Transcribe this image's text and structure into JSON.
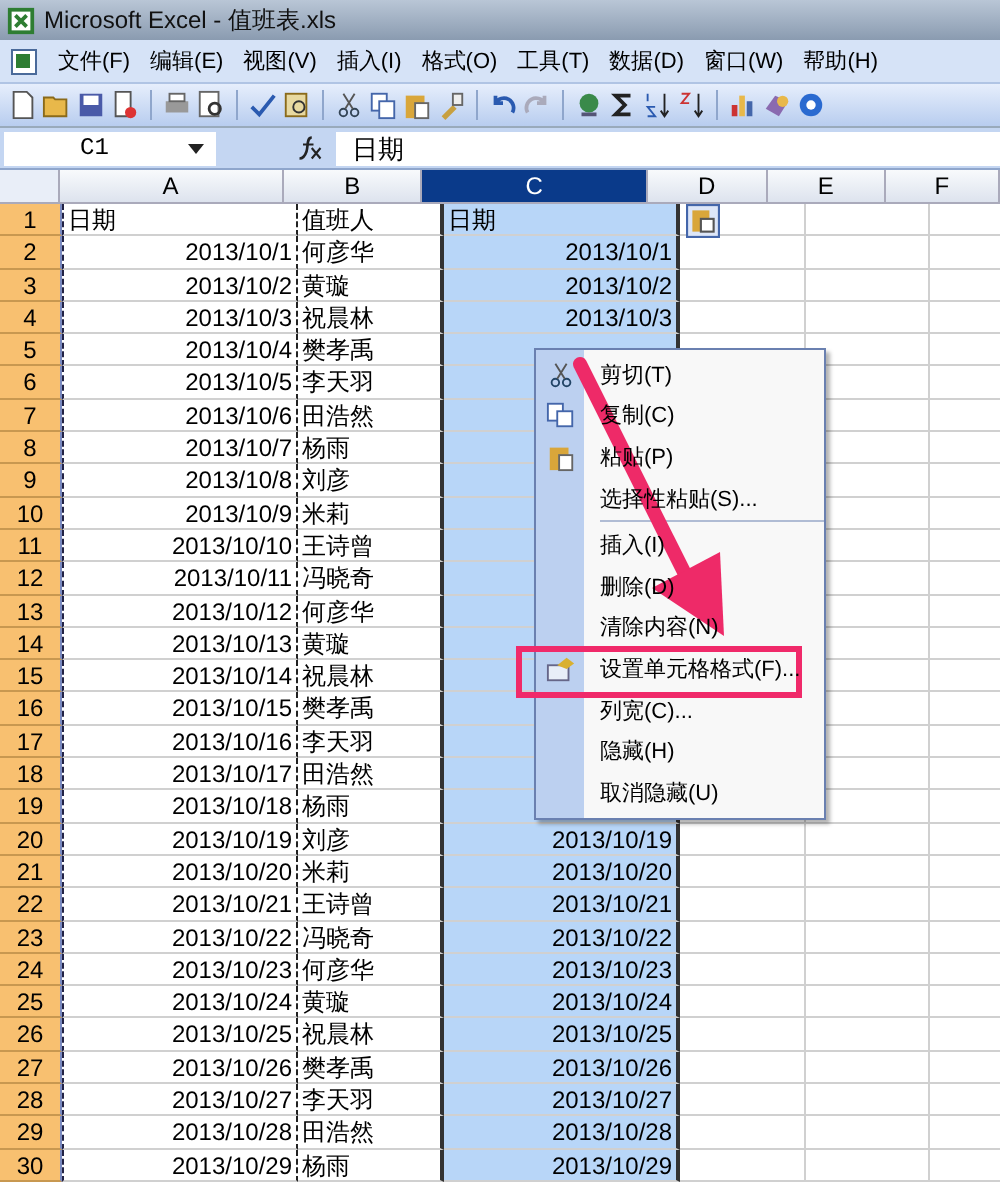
{
  "window": {
    "title": "Microsoft Excel - 值班表.xls"
  },
  "menu_bar": [
    {
      "label": "文件(F)"
    },
    {
      "label": "编辑(E)"
    },
    {
      "label": "视图(V)"
    },
    {
      "label": "插入(I)"
    },
    {
      "label": "格式(O)"
    },
    {
      "label": "工具(T)"
    },
    {
      "label": "数据(D)"
    },
    {
      "label": "窗口(W)"
    },
    {
      "label": "帮助(H)"
    }
  ],
  "name_box": "C1",
  "formula": "日期",
  "columns": [
    {
      "label": "A",
      "selected": false
    },
    {
      "label": "B",
      "selected": false
    },
    {
      "label": "C",
      "selected": true
    },
    {
      "label": "D",
      "selected": false
    },
    {
      "label": "E",
      "selected": false
    },
    {
      "label": "F",
      "selected": false
    }
  ],
  "rows": [
    {
      "number": "1",
      "cells": [
        "日期",
        "值班人",
        "日期"
      ]
    },
    {
      "number": "2",
      "cells": [
        "2013/10/1",
        "何彦华",
        "2013/10/1"
      ]
    },
    {
      "number": "3",
      "cells": [
        "2013/10/2",
        "黄璇",
        "2013/10/2"
      ]
    },
    {
      "number": "4",
      "cells": [
        "2013/10/3",
        "祝晨林",
        "2013/10/3"
      ]
    },
    {
      "number": "5",
      "cells": [
        "2013/10/4",
        "樊孝禹",
        null
      ]
    },
    {
      "number": "6",
      "cells": [
        "2013/10/5",
        "李天羽",
        null
      ]
    },
    {
      "number": "7",
      "cells": [
        "2013/10/6",
        "田浩然",
        null
      ]
    },
    {
      "number": "8",
      "cells": [
        "2013/10/7",
        "杨雨",
        null
      ]
    },
    {
      "number": "9",
      "cells": [
        "2013/10/8",
        "刘彦",
        null
      ]
    },
    {
      "number": "10",
      "cells": [
        "2013/10/9",
        "米莉",
        null
      ]
    },
    {
      "number": "11",
      "cells": [
        "2013/10/10",
        "王诗曾",
        null
      ]
    },
    {
      "number": "12",
      "cells": [
        "2013/10/11",
        "冯晓奇",
        null
      ]
    },
    {
      "number": "13",
      "cells": [
        "2013/10/12",
        "何彦华",
        null
      ]
    },
    {
      "number": "14",
      "cells": [
        "2013/10/13",
        "黄璇",
        null
      ]
    },
    {
      "number": "15",
      "cells": [
        "2013/10/14",
        "祝晨林",
        null
      ]
    },
    {
      "number": "16",
      "cells": [
        "2013/10/15",
        "樊孝禹",
        null
      ]
    },
    {
      "number": "17",
      "cells": [
        "2013/10/16",
        "李天羽",
        null
      ]
    },
    {
      "number": "18",
      "cells": [
        "2013/10/17",
        "田浩然",
        null
      ]
    },
    {
      "number": "19",
      "cells": [
        "2013/10/18",
        "杨雨",
        null
      ]
    },
    {
      "number": "20",
      "cells": [
        "2013/10/19",
        "刘彦",
        "2013/10/19"
      ]
    },
    {
      "number": "21",
      "cells": [
        "2013/10/20",
        "米莉",
        "2013/10/20"
      ]
    },
    {
      "number": "22",
      "cells": [
        "2013/10/21",
        "王诗曾",
        "2013/10/21"
      ]
    },
    {
      "number": "23",
      "cells": [
        "2013/10/22",
        "冯晓奇",
        "2013/10/22"
      ]
    },
    {
      "number": "24",
      "cells": [
        "2013/10/23",
        "何彦华",
        "2013/10/23"
      ]
    },
    {
      "number": "25",
      "cells": [
        "2013/10/24",
        "黄璇",
        "2013/10/24"
      ]
    },
    {
      "number": "26",
      "cells": [
        "2013/10/25",
        "祝晨林",
        "2013/10/25"
      ]
    },
    {
      "number": "27",
      "cells": [
        "2013/10/26",
        "樊孝禹",
        "2013/10/26"
      ]
    },
    {
      "number": "28",
      "cells": [
        "2013/10/27",
        "李天羽",
        "2013/10/27"
      ]
    },
    {
      "number": "29",
      "cells": [
        "2013/10/28",
        "田浩然",
        "2013/10/28"
      ]
    },
    {
      "number": "30",
      "cells": [
        "2013/10/29",
        "杨雨",
        "2013/10/29"
      ]
    }
  ],
  "context_menu": {
    "items": [
      {
        "label": "剪切(T)",
        "kind": "cut",
        "separator_before": false,
        "annotated": false
      },
      {
        "label": "复制(C)",
        "kind": "copy",
        "separator_before": false,
        "annotated": false
      },
      {
        "label": "粘贴(P)",
        "kind": "paste",
        "separator_before": false,
        "annotated": false
      },
      {
        "label": "选择性粘贴(S)...",
        "kind": "plain",
        "separator_before": false,
        "annotated": false
      },
      {
        "label": "插入(I)",
        "kind": "plain",
        "separator_before": true,
        "annotated": false
      },
      {
        "label": "删除(D)",
        "kind": "plain",
        "separator_before": false,
        "annotated": false
      },
      {
        "label": "清除内容(N)",
        "kind": "plain",
        "separator_before": false,
        "annotated": false
      },
      {
        "label": "设置单元格格式(F)...",
        "kind": "format",
        "separator_before": false,
        "annotated": true
      },
      {
        "label": "列宽(C)...",
        "kind": "plain",
        "separator_before": false,
        "annotated": false
      },
      {
        "label": "隐藏(H)",
        "kind": "plain",
        "separator_before": false,
        "annotated": false
      },
      {
        "label": "取消隐藏(U)",
        "kind": "plain",
        "separator_before": false,
        "annotated": false
      }
    ]
  }
}
